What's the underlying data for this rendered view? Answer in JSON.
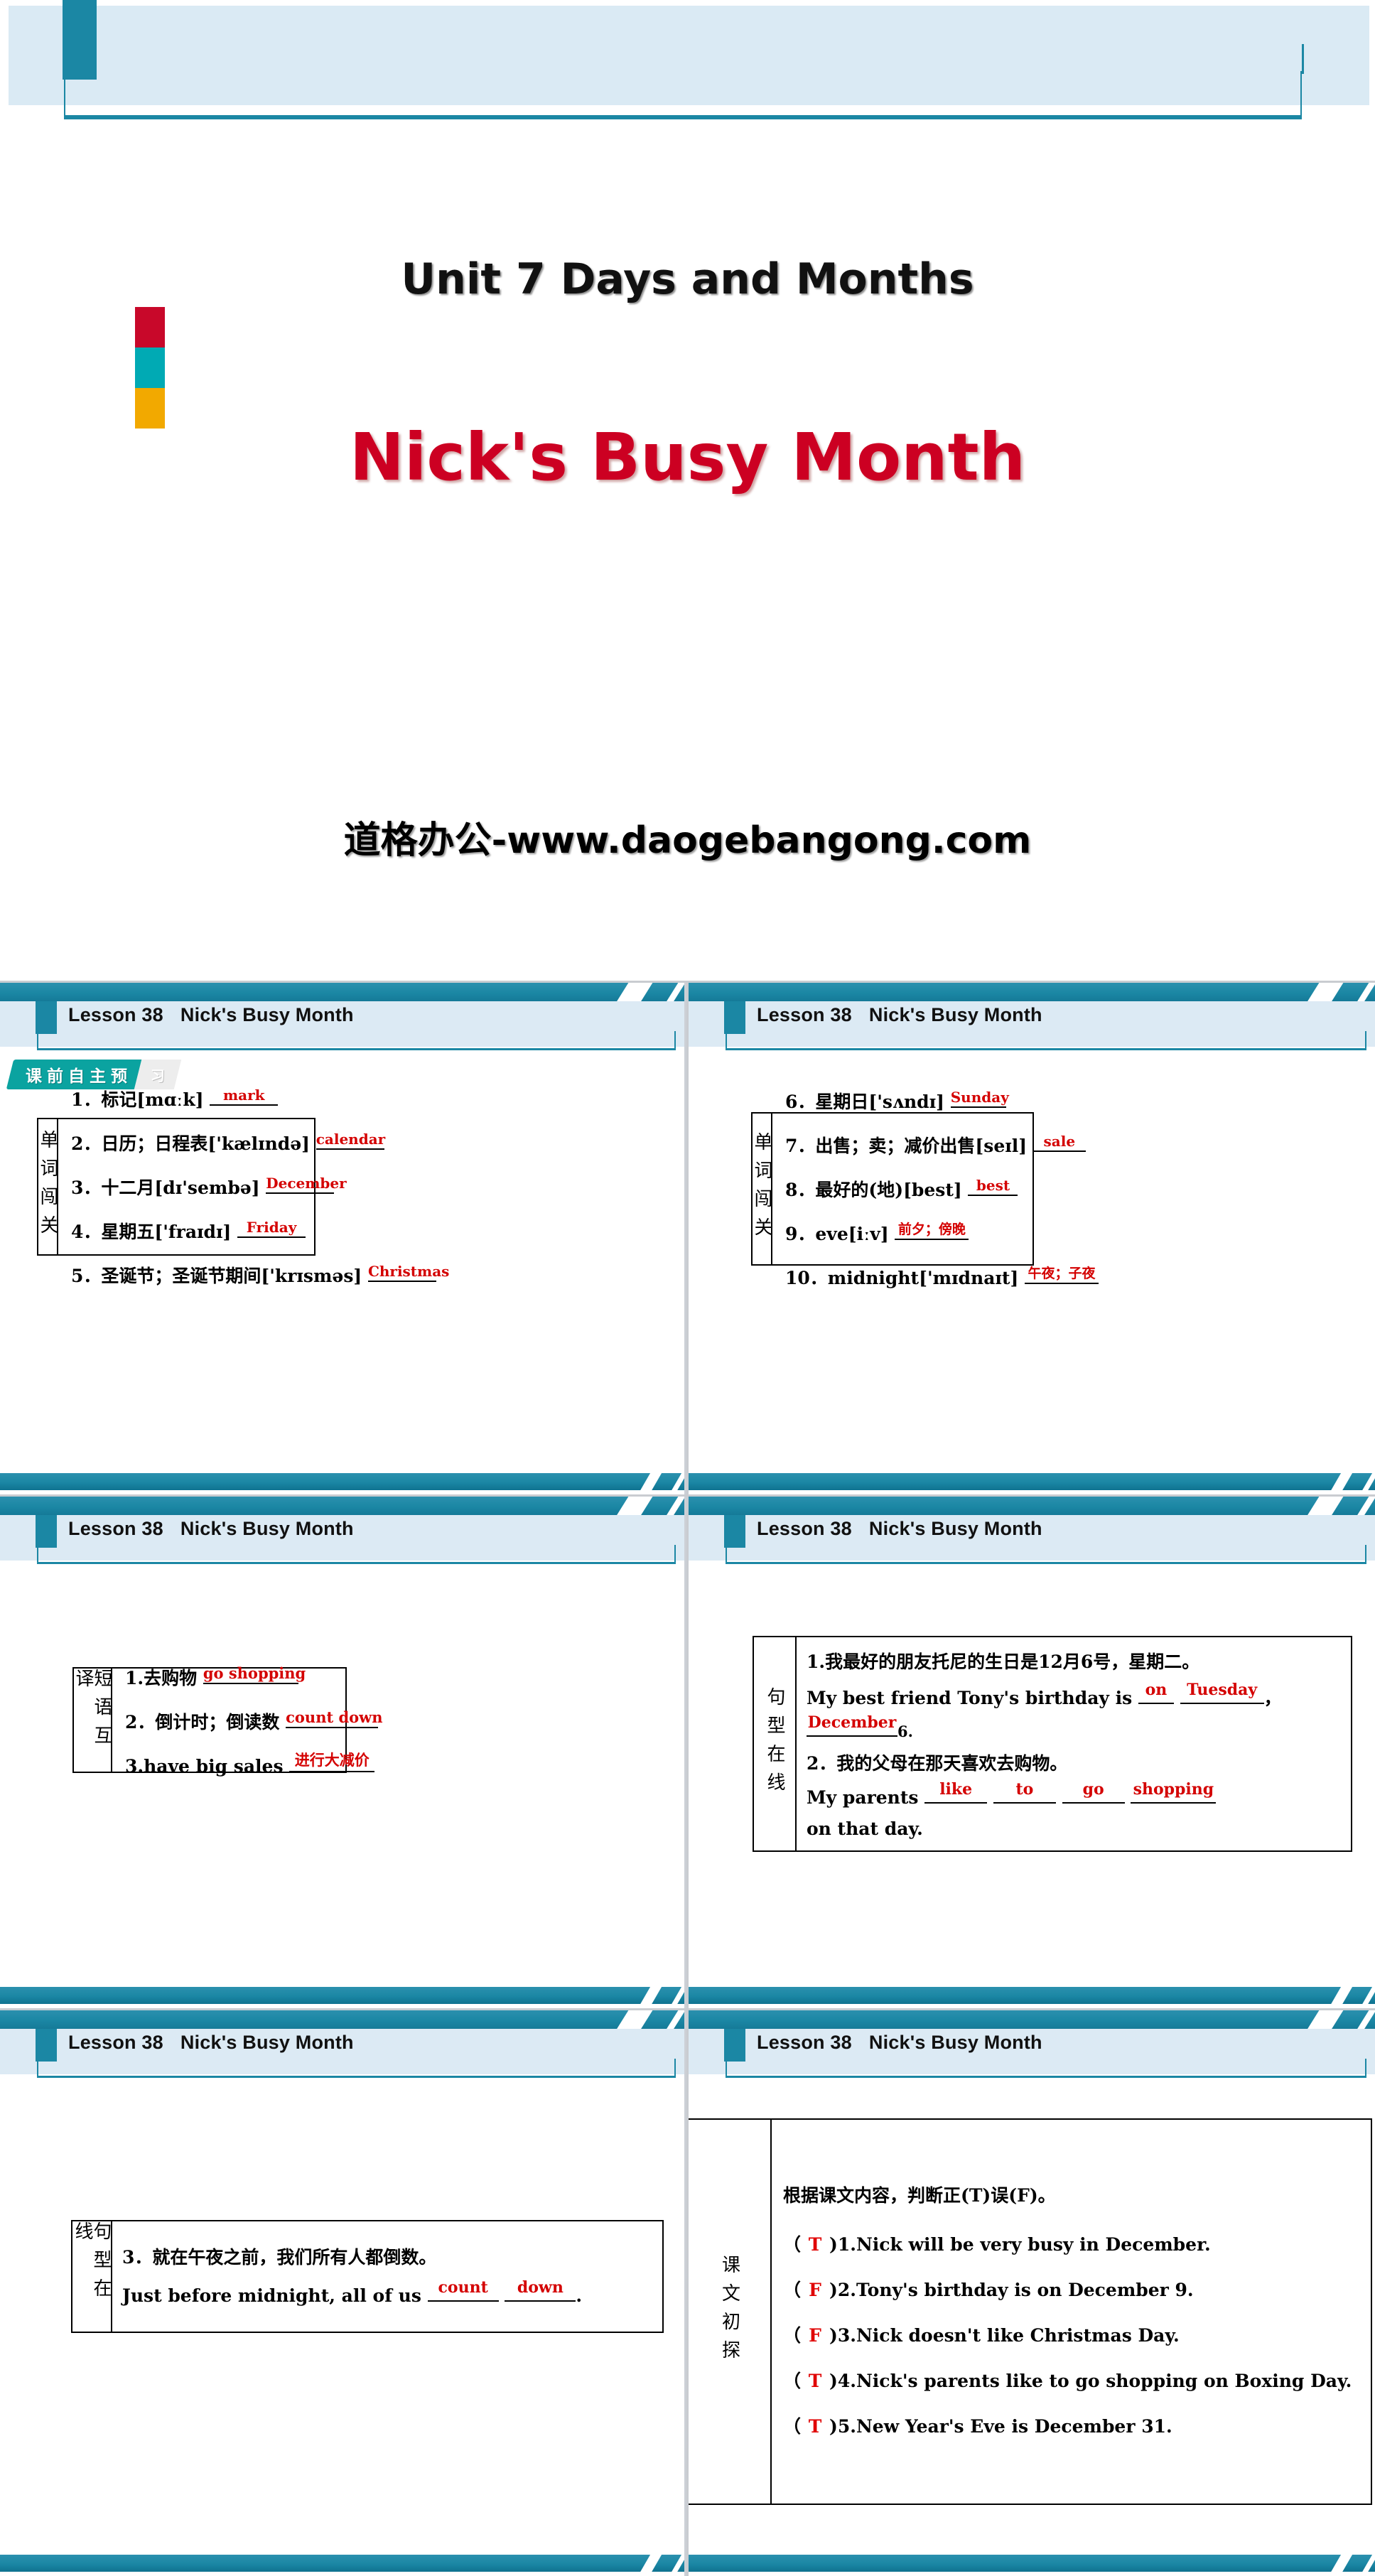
{
  "hero": {
    "unit_title": "Unit 7 Days and Months",
    "main_title": "Nick's Busy Month",
    "watermark": "道格办公-www.daogebangong.com",
    "chip_colors": [
      "#c8082a",
      "#00aab4",
      "#f2a900"
    ]
  },
  "theme": {
    "teal": "#1b87a4",
    "light_blue": "#dceaf4",
    "answer_red": "#d40000",
    "badge_green": "#0ba3a0"
  },
  "lesson_header": {
    "lesson": "Lesson 38",
    "title": "Nick's Busy Month"
  },
  "badge": {
    "main": "课前自主预",
    "tail": "习"
  },
  "slides": [
    {
      "label": "单词闯关",
      "rows": [
        {
          "num": "1．",
          "cn": "标记",
          "ipa": "[mɑːk]",
          "answer": "mark"
        },
        {
          "num": "2．",
          "cn": "日历；日程表",
          "ipa": "['kælɪndə]",
          "answer": "calendar"
        },
        {
          "num": "3．",
          "cn": "十二月",
          "ipa": "[dɪ'sembə]",
          "answer": "December"
        },
        {
          "num": "4．",
          "cn": "星期五",
          "ipa": "['fraɪdɪ]",
          "answer": "Friday"
        },
        {
          "num": "5．",
          "cn": "圣诞节；圣诞节期间",
          "ipa": "['krɪsməs]",
          "answer": "Christmas"
        }
      ]
    },
    {
      "label": "单词闯关",
      "rows": [
        {
          "num": "6．",
          "cn": "星期日",
          "ipa": "['sʌndɪ]",
          "answer": "Sunday"
        },
        {
          "num": "7．",
          "cn": "出售；卖；减价出售",
          "ipa": "[seɪl]",
          "answer": "sale"
        },
        {
          "num": "8．",
          "cn": "最好的(地)",
          "ipa": "[best]",
          "answer": "best"
        },
        {
          "num": "9．",
          "cn": "eve",
          "ipa": "[iːv]",
          "answer": "前夕；傍晚"
        },
        {
          "num": "10．",
          "cn": "midnight",
          "ipa": "['mɪdnaɪt]",
          "answer": "午夜；子夜"
        }
      ]
    },
    {
      "label": "短语互译",
      "rows": [
        {
          "num": "1.",
          "cn": "去购物",
          "ipa": "",
          "answer": "go shopping"
        },
        {
          "num": "2．",
          "cn": "倒计时；倒读数",
          "ipa": "",
          "answer": "count down"
        },
        {
          "num": "3.",
          "cn": "have big sales",
          "ipa": "",
          "answer": "进行大减价"
        }
      ]
    },
    {
      "label": "句型在线",
      "q1_cn": "1.我最好的朋友托尼的生日是12月6号，星期二。",
      "q1_en_a": "My best friend Tony's birthday is",
      "q1_b1": "on",
      "q1_b2": "Tuesday",
      "q1_comma": "，",
      "q1_b3": "December",
      "q1_tail": "6.",
      "q2_cn": "2．我的父母在那天喜欢去购物。",
      "q2_en_a": "My parents",
      "q2_b1": "like",
      "q2_b2": "to",
      "q2_b3": "go",
      "q2_b4": "shopping",
      "q2_tail": "on that day."
    },
    {
      "label": "句型在线",
      "q3_cn": "3．就在午夜之前，我们所有人都倒数。",
      "q3_en_a": "Just before midnight, all of us",
      "q3_b1": "count",
      "q3_b2": "down",
      "q3_tail": "."
    },
    {
      "label": "课文初探",
      "instruction": "根据课文内容，判断正(T)误(F)。",
      "items": [
        {
          "mark": "T",
          "text": ")1.Nick will be very busy in December."
        },
        {
          "mark": "F",
          "text": ")2.Tony's birthday is on December 9."
        },
        {
          "mark": "F",
          "text": ")3.Nick doesn't like Christmas Day."
        },
        {
          "mark": "T",
          "text": ")4.Nick's parents like to go shopping on Boxing Day."
        },
        {
          "mark": "T",
          "text": ")5.New Year's Eve is December 31."
        }
      ],
      "paren_open": "（"
    }
  ]
}
